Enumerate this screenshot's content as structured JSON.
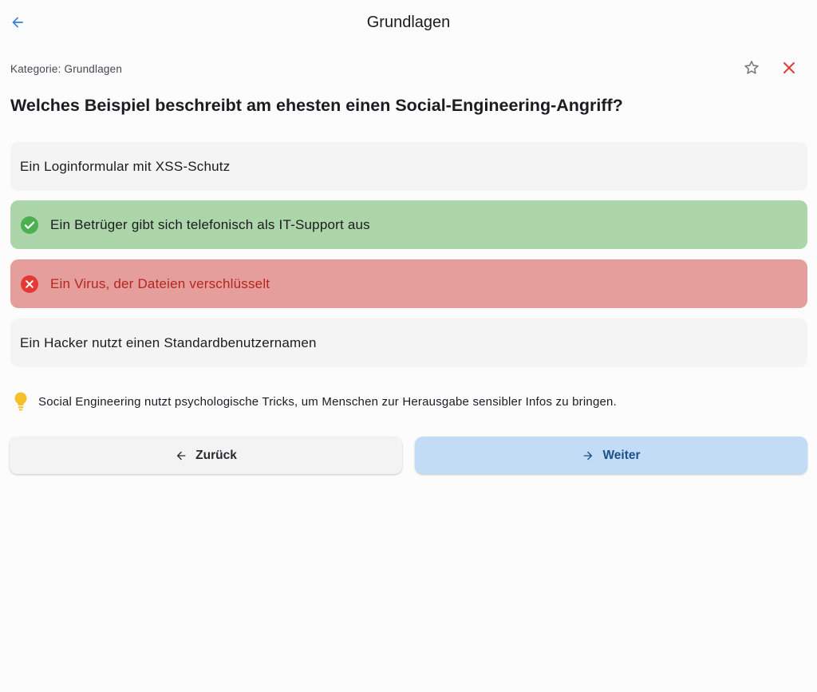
{
  "appbar": {
    "title": "Grundlagen",
    "back_icon": "arrow-back-icon",
    "accent": "#2f7fe0"
  },
  "meta": {
    "category": "Kategorie: Grundlagen",
    "favorite_icon": "star-outline-icon",
    "close_icon": "close-icon",
    "close_color": "#e53935"
  },
  "question": {
    "text": "Welches Beispiel beschreibt am ehesten einen Social-Engineering-Angriff?"
  },
  "options": [
    {
      "label": "Ein Loginformular mit XSS-Schutz",
      "state": "neutral"
    },
    {
      "label": "Ein Betrüger gibt sich telefonisch als IT-Support aus",
      "state": "correct",
      "icon": "check-circle-icon"
    },
    {
      "label": "Ein Virus, der Dateien verschlüsselt",
      "state": "wrong",
      "icon": "cancel-circle-icon"
    },
    {
      "label": "Ein Hacker nutzt einen Standardbenutzernamen",
      "state": "neutral"
    }
  ],
  "hint": {
    "icon": "lightbulb-icon",
    "text": "Social Engineering nutzt psychologische Tricks, um Menschen zur Herausgabe sensibler Infos zu bringen."
  },
  "buttons": {
    "back_label": "Zurück",
    "back_icon": "arrow-left-icon",
    "next_label": "Weiter",
    "next_icon": "arrow-right-icon"
  },
  "colors": {
    "correct_bg": "#acd5a9",
    "wrong_bg": "#e59e9c",
    "neutral_bg": "#f4f4f4",
    "next_bg": "#c2dcf6"
  }
}
